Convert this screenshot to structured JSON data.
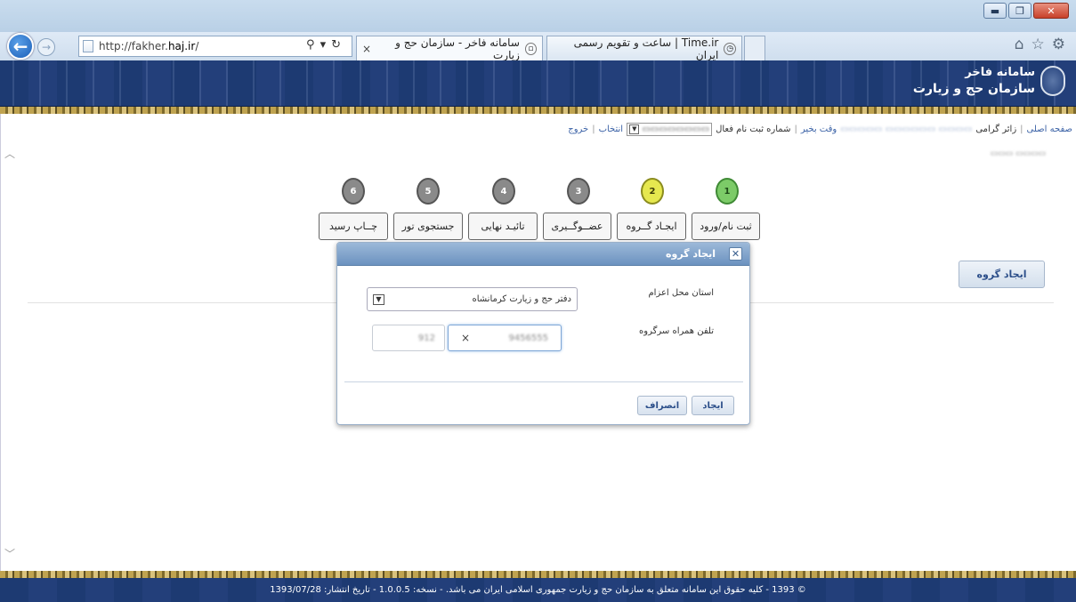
{
  "browser": {
    "url_prefix": "http://fakher.",
    "url_domain": "haj.ir",
    "url_suffix": "/",
    "tabs": [
      {
        "title": "سامانه فاخر - سازمان حج و زیارت",
        "close": "×"
      },
      {
        "title": "Time.ir | ساعت و تقویم رسمی ایران"
      }
    ],
    "window_controls": {
      "minimize": "▬",
      "restore": "❐",
      "close": "✕"
    },
    "toolbar_icons": [
      "home-icon",
      "star-icon",
      "gear-icon"
    ]
  },
  "site": {
    "title_line1": "سامانه فاخر",
    "title_line2": "سازمان حج و زیارت"
  },
  "topnav": {
    "home": "صفحه اصلی",
    "greeting_prefix": "زائر گرامی",
    "greeting_suffix": "وقت بخیر",
    "active_reg_label": "شماره ثبت نام فعال",
    "select_label": "انتخاب",
    "logout": "خروج"
  },
  "steps": [
    {
      "number": "1",
      "label": "ثبت نام/ورود",
      "status": "done"
    },
    {
      "number": "2",
      "label": "ایجـاد گــروه",
      "status": "current"
    },
    {
      "number": "3",
      "label": "عضــوگــیری",
      "status": "pending"
    },
    {
      "number": "4",
      "label": "تائیـد نهایی",
      "status": "pending"
    },
    {
      "number": "5",
      "label": "جستجوی تور",
      "status": "pending"
    },
    {
      "number": "6",
      "label": "چــاپ رسید",
      "status": "pending"
    }
  ],
  "create_group_button": "ایجاد گروه",
  "dialog": {
    "title": "ایجاد گروه",
    "close": "✕",
    "province_label": "استان محل اعزام",
    "province_value": "دفتر حج و زیارت کرمانشاه",
    "phone_label": "تلفن همراه سرگروه",
    "phone_prefix": "912",
    "phone_number": "9456555",
    "clear": "×",
    "create_button": "ایجاد",
    "cancel_button": "انصراف"
  },
  "footer": {
    "text": "© 1393 - کلیه حقوق این سامانه متعلق به سازمان حج و زیارت جمهوری اسلامی ایران می باشد. - نسخه: 1.0.0.5 - تاریخ انتشار: 1393/07/28"
  },
  "colors": {
    "banner": "#1d3a72",
    "step_done": "#7ccb68",
    "step_current": "#e6e84f",
    "step_pending": "#8a8a8a",
    "dialog_header": "#6b92c0"
  }
}
